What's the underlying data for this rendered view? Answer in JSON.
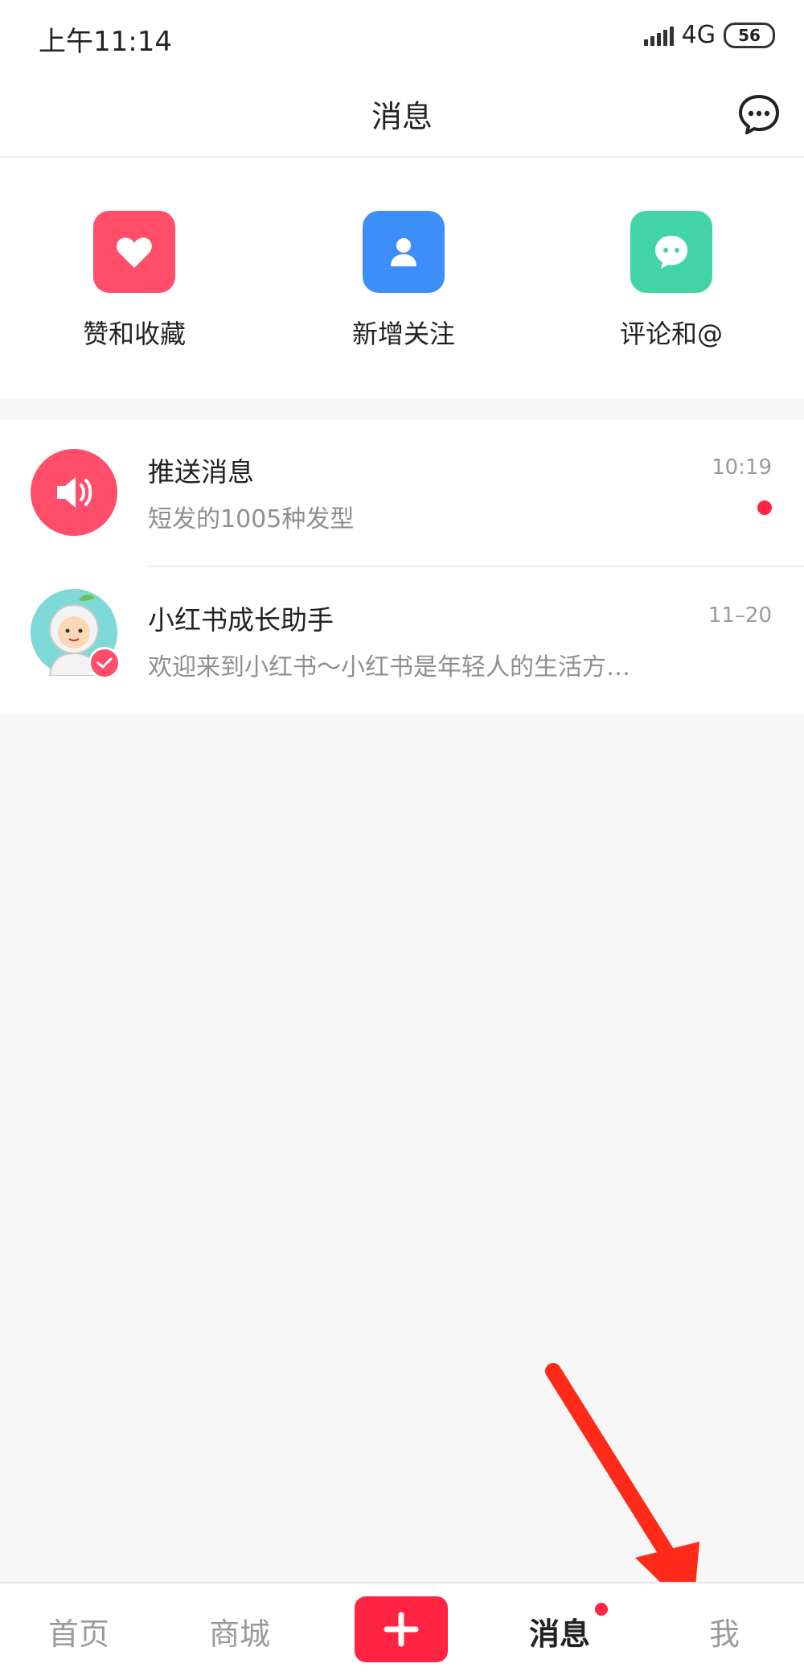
{
  "status": {
    "time": "上午11:14",
    "network": "4G",
    "battery": "56"
  },
  "header": {
    "title": "消息"
  },
  "quick_actions": [
    {
      "label": "赞和收藏",
      "color": "#ff4d6a",
      "icon": "heart-icon"
    },
    {
      "label": "新增关注",
      "color": "#3d8ff7",
      "icon": "person-icon"
    },
    {
      "label": "评论和@",
      "color": "#42d4a6",
      "icon": "comment-icon"
    }
  ],
  "messages": [
    {
      "title": "推送消息",
      "subtitle": "短发的1005种发型",
      "time": "10:19",
      "unread": true,
      "icon": "speaker-icon"
    },
    {
      "title": "小红书成长助手",
      "subtitle": "欢迎来到小红书～小红书是年轻人的生活方…",
      "time": "11–20",
      "unread": false,
      "icon": "astronaut-avatar"
    }
  ],
  "tabbar": {
    "home": "首页",
    "mall": "商城",
    "messages": "消息",
    "me": "我"
  },
  "colors": {
    "accent": "#ff2442",
    "arrow": "#ff2a1a"
  }
}
